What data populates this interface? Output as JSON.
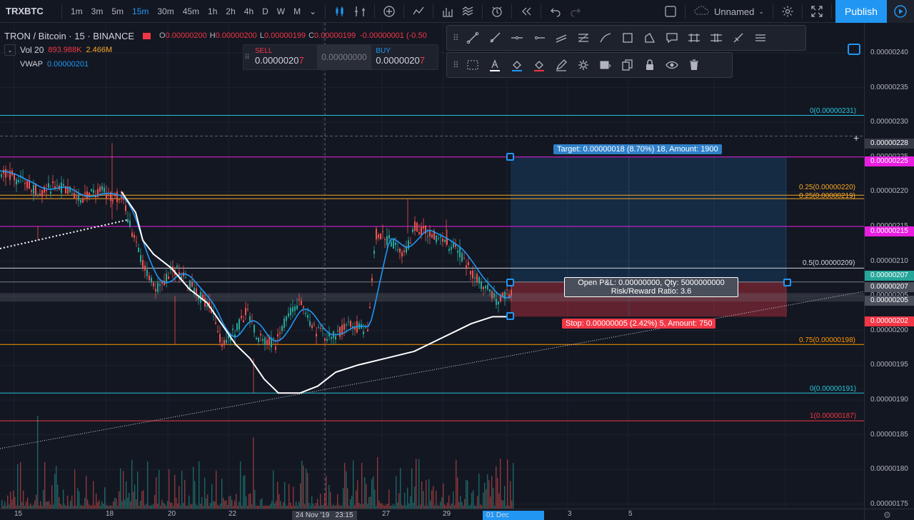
{
  "topbar": {
    "symbol": "TRXBTC",
    "intervals": [
      "1m",
      "3m",
      "5m",
      "15m",
      "30m",
      "45m",
      "1h",
      "2h",
      "4h",
      "D",
      "W",
      "M"
    ],
    "active_interval": "15m",
    "layout_name": "Unnamed",
    "publish_label": "Publish"
  },
  "legend": {
    "title": "TRON / Bitcoin · 15 · BINANCE",
    "ohlc": [
      {
        "k": "O",
        "v": "0.00000200"
      },
      {
        "k": "H",
        "v": "0.00000200"
      },
      {
        "k": "L",
        "v": "0.00000199"
      },
      {
        "k": "C",
        "v": "0.00000199"
      }
    ],
    "change": "-0.00000001 (-0.50",
    "vol_label": "Vol 20",
    "vol_value1": "893.988K",
    "vol_value2": "2.466M",
    "vwap_label": "VWAP",
    "vwap_value": "0.00000201"
  },
  "trade_widget": {
    "sell_label": "SELL",
    "sell_price": "0.0000020",
    "sell_last": "7",
    "spread": "0.00000000",
    "buy_label": "BUY",
    "buy_price": "0.0000020",
    "buy_last": "7"
  },
  "price_axis": {
    "labels": [
      "0.00000240",
      "0.00000235",
      "0.00000230",
      "0.00000225",
      "0.00000220",
      "0.00000215",
      "0.00000210",
      "0.00000205",
      "0.00000200",
      "0.00000195",
      "0.00000190",
      "0.00000185",
      "0.00000180",
      "0.00000175"
    ],
    "tags": [
      {
        "text": "0.00000228",
        "color": "#363a45"
      },
      {
        "text": "0.00000225",
        "color": "#e91ee0"
      },
      {
        "text": "0.00000215",
        "color": "#e91ee0"
      },
      {
        "text": "0.00000207",
        "color": "#26a69a"
      },
      {
        "text": "0.00000207",
        "color": "#4a4f5c"
      },
      {
        "text": "0.00000205",
        "color": "#4a4f5c"
      },
      {
        "text": "0.00000202",
        "color": "#f23645"
      }
    ]
  },
  "time_axis": {
    "labels": [
      "15",
      "18",
      "20",
      "22",
      "27",
      "29",
      "3",
      "5"
    ],
    "tag1_date": "24 Nov '19",
    "tag1_time": "23:15",
    "tag2_date": "01 Dec '19",
    "tag2_time": "05:45"
  },
  "fib_levels": [
    {
      "text": "0(0.00000231)",
      "color": "#26c6da"
    },
    {
      "text": "0.25(0.00000220)",
      "color": "#f9a825"
    },
    {
      "text": "0.25(0.00000219)",
      "color": "#f9a825"
    },
    {
      "text": "0.5(0.00000209)",
      "color": "#d1d4dc"
    },
    {
      "text": "0.75(0.00000198)",
      "color": "#ff9800"
    },
    {
      "text": "0(0.00000191)",
      "color": "#26c6da"
    },
    {
      "text": "1(0.00000187)",
      "color": "#f23645"
    }
  ],
  "position": {
    "target": "Target: 0.00000018 (8.70%) 18, Amount: 1900",
    "pnl_line1": "Open P&L: 0.00000000, Qty: 5000000000",
    "pnl_line2": "Risk/Reward Ratio: 3.6",
    "stop": "Stop: 0.00000005 (2.42%) 5, Amount: 750"
  },
  "colors": {
    "background": "#131722",
    "accent": "#2196f3",
    "up": "#26a69a",
    "down": "#ef5350"
  },
  "toolbar_icons": [
    "trend-line-icon",
    "ray-icon",
    "horizontal-line-icon",
    "horizontal-ray-icon",
    "parallel-channel-icon",
    "fib-retracement-icon",
    "brush-icon",
    "rectangle-icon",
    "path-icon",
    "callout-icon",
    "long-position-icon",
    "short-position-icon",
    "pitchfork-icon",
    "more-tools-icon"
  ],
  "props_icons": [
    "line-style-icon",
    "text-color-icon",
    "fill-color-icon",
    "background-color-icon",
    "pencil-icon",
    "settings-icon",
    "visual-order-icon",
    "clone-icon",
    "lock-icon",
    "visibility-icon",
    "trash-icon"
  ]
}
